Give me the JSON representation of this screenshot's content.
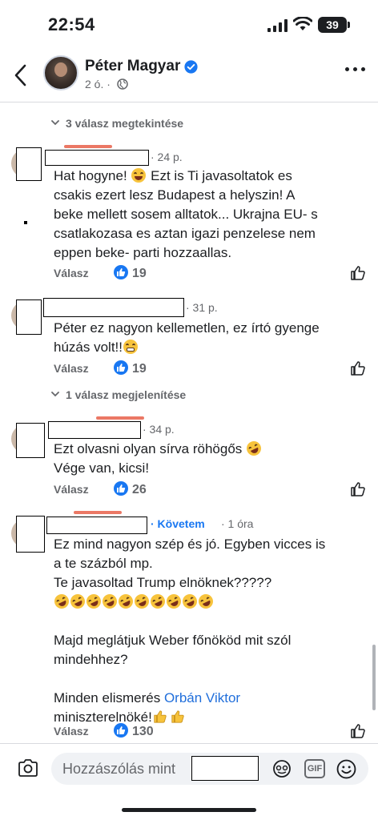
{
  "status_bar": {
    "time": "22:54",
    "battery": "39"
  },
  "header": {
    "name": "Péter Magyar",
    "subtitle": "2 ó. ·"
  },
  "threads": [
    {
      "replies_label": "3 válasz megtekintése"
    },
    {
      "replies_label": "1 válasz megjelenítése"
    }
  ],
  "comments": [
    {
      "time": "· 24 p.",
      "lines": [
        "Hat hogyne! ",
        "Ezt is Ti javasoltatok es",
        "csakis ezert lesz Budapest a helyszin! A",
        "beke mellett sosem alltatok... Ukrajna EU- s",
        "csatlakozasa es aztan igazi penzelese nem",
        "eppen beke- parti hozzaallas."
      ],
      "emoji": [
        "grinning-sweat"
      ],
      "reply_label": "Válasz",
      "likes": "19"
    },
    {
      "time": "· 31 p.",
      "lines": [
        "Péter ez nagyon kellemetlen, ez írtó gyenge",
        "húzás volt!!"
      ],
      "emoji": [
        "grimacing"
      ],
      "reply_label": "Válasz",
      "likes": "19"
    },
    {
      "time": "· 34 p.",
      "lines": [
        "Ezt olvasni olyan sírva röhögős ",
        "Vége van, kicsi!"
      ],
      "emoji": [
        "rofl"
      ],
      "reply_label": "Válasz",
      "likes": "26"
    },
    {
      "follow_label": "· Követem",
      "time": "· 1 óra",
      "lines": [
        "Ez mind nagyon szép és jó. Egyben vicces is",
        "a te százból mp.",
        "Te javasoltad Trump elnöknek?????",
        "Majd meglátjuk Weber főnököd mit szól",
        "mindehhez?",
        "Minden elismerés ",
        "Orbán Viktor",
        "miniszterelnöké!"
      ],
      "emoji": [
        "rofl",
        "thumbs-up"
      ],
      "reply_label": "Válasz",
      "likes": "130"
    }
  ],
  "composer": {
    "placeholder": "Hozzászólás mint"
  },
  "icons": [
    "back-arrow",
    "verified-badge",
    "globe",
    "more-dots",
    "chevron-down",
    "like-thumb",
    "camera",
    "sticker",
    "gif",
    "emoji-smile"
  ],
  "colors": {
    "accent": "#1877f2",
    "text": "#1c1e21",
    "muted": "#65676b",
    "link": "#216fdb"
  }
}
